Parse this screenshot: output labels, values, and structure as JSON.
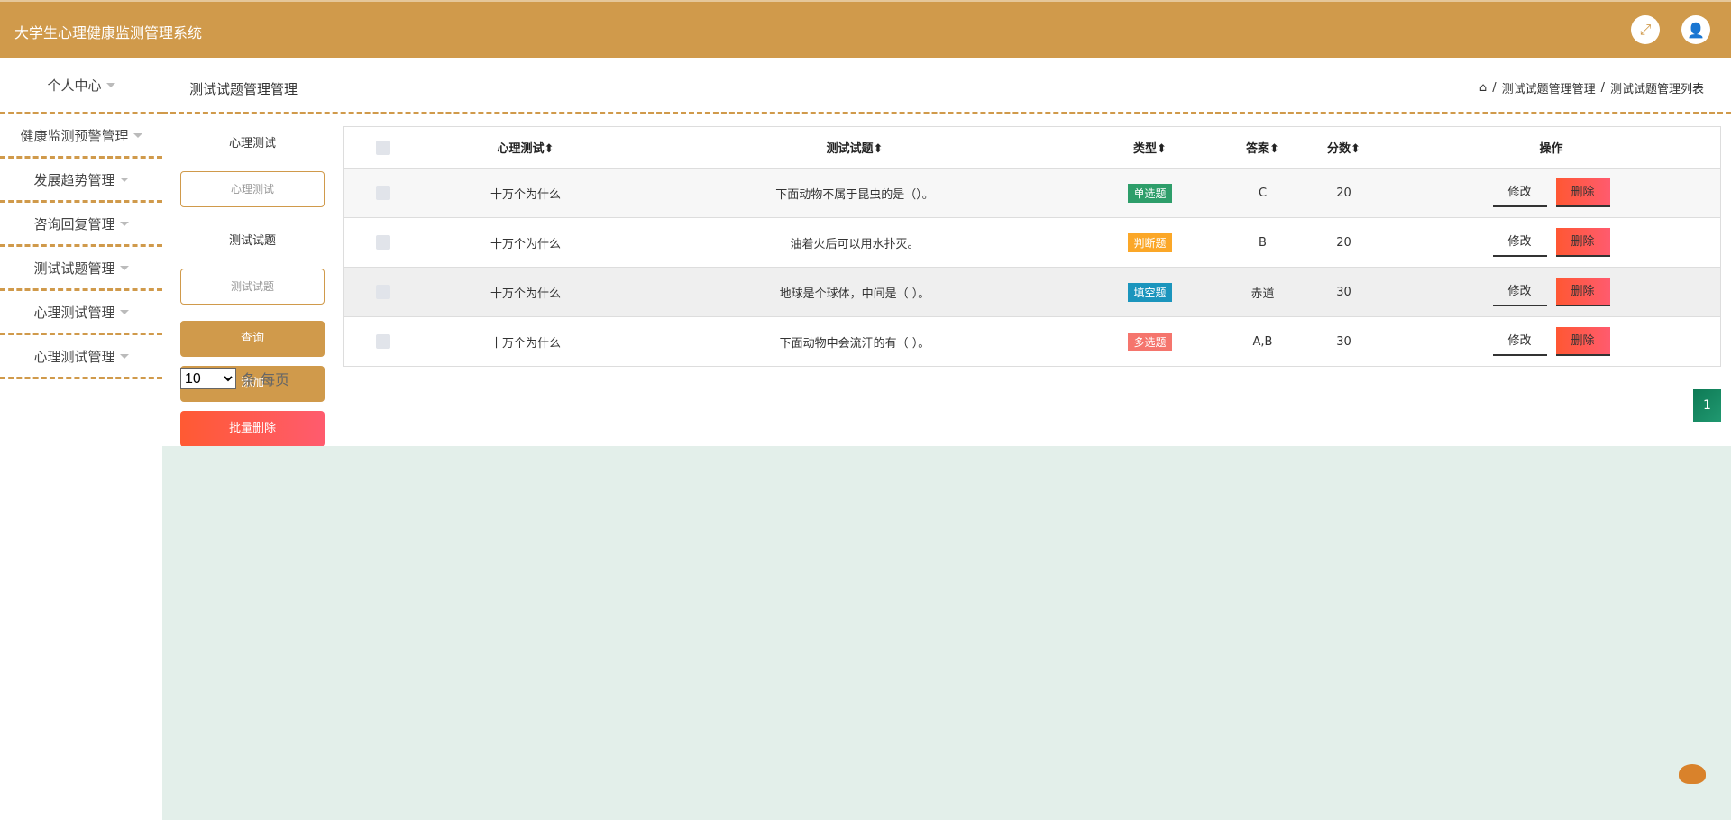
{
  "header": {
    "title": "大学生心理健康监测管理系统",
    "icons": [
      "fullscreen-icon",
      "user-icon"
    ]
  },
  "sidebar": {
    "items": [
      "个人中心",
      "健康监测预警管理",
      "发展趋势管理",
      "咨询回复管理",
      "测试试题管理",
      "心理测试管理",
      "心理测试管理"
    ]
  },
  "page": {
    "title": "测试试题管理管理",
    "breadcrumb": [
      "测试试题管理管理",
      "测试试题管理列表"
    ]
  },
  "search": {
    "label1": "心理测试",
    "placeholder1": "心理测试",
    "label2": "测试试题",
    "placeholder2": "测试试题",
    "query": "查询",
    "add": "添加",
    "batch_delete": "批量删除"
  },
  "pagesize": {
    "value": "10",
    "suffix": "条 每页"
  },
  "table": {
    "headers": [
      "心理测试",
      "测试试题",
      "类型",
      "答案",
      "分数",
      "操作"
    ],
    "sort_glyph": "⬍",
    "rows": [
      {
        "test": "十万个为什么",
        "question": "下面动物不属于昆虫的是（）。",
        "type": "单选题",
        "type_color": "#2e9e6a",
        "answer": "C",
        "score": "20"
      },
      {
        "test": "十万个为什么",
        "question": "油着火后可以用水扑灭。",
        "type": "判断题",
        "type_color": "#fba728",
        "answer": "B",
        "score": "20"
      },
      {
        "test": "十万个为什么",
        "question": "地球是个球体，中间是（ ）。",
        "type": "填空题",
        "type_color": "#1b95bd",
        "answer": "赤道",
        "score": "30"
      },
      {
        "test": "十万个为什么",
        "question": "下面动物中会流汗的有（ ）。",
        "type": "多选题",
        "type_color": "#f5756d",
        "answer": "A,B",
        "score": "30"
      }
    ],
    "edit": "修改",
    "delete": "删除"
  },
  "pagination": {
    "current": "1"
  }
}
